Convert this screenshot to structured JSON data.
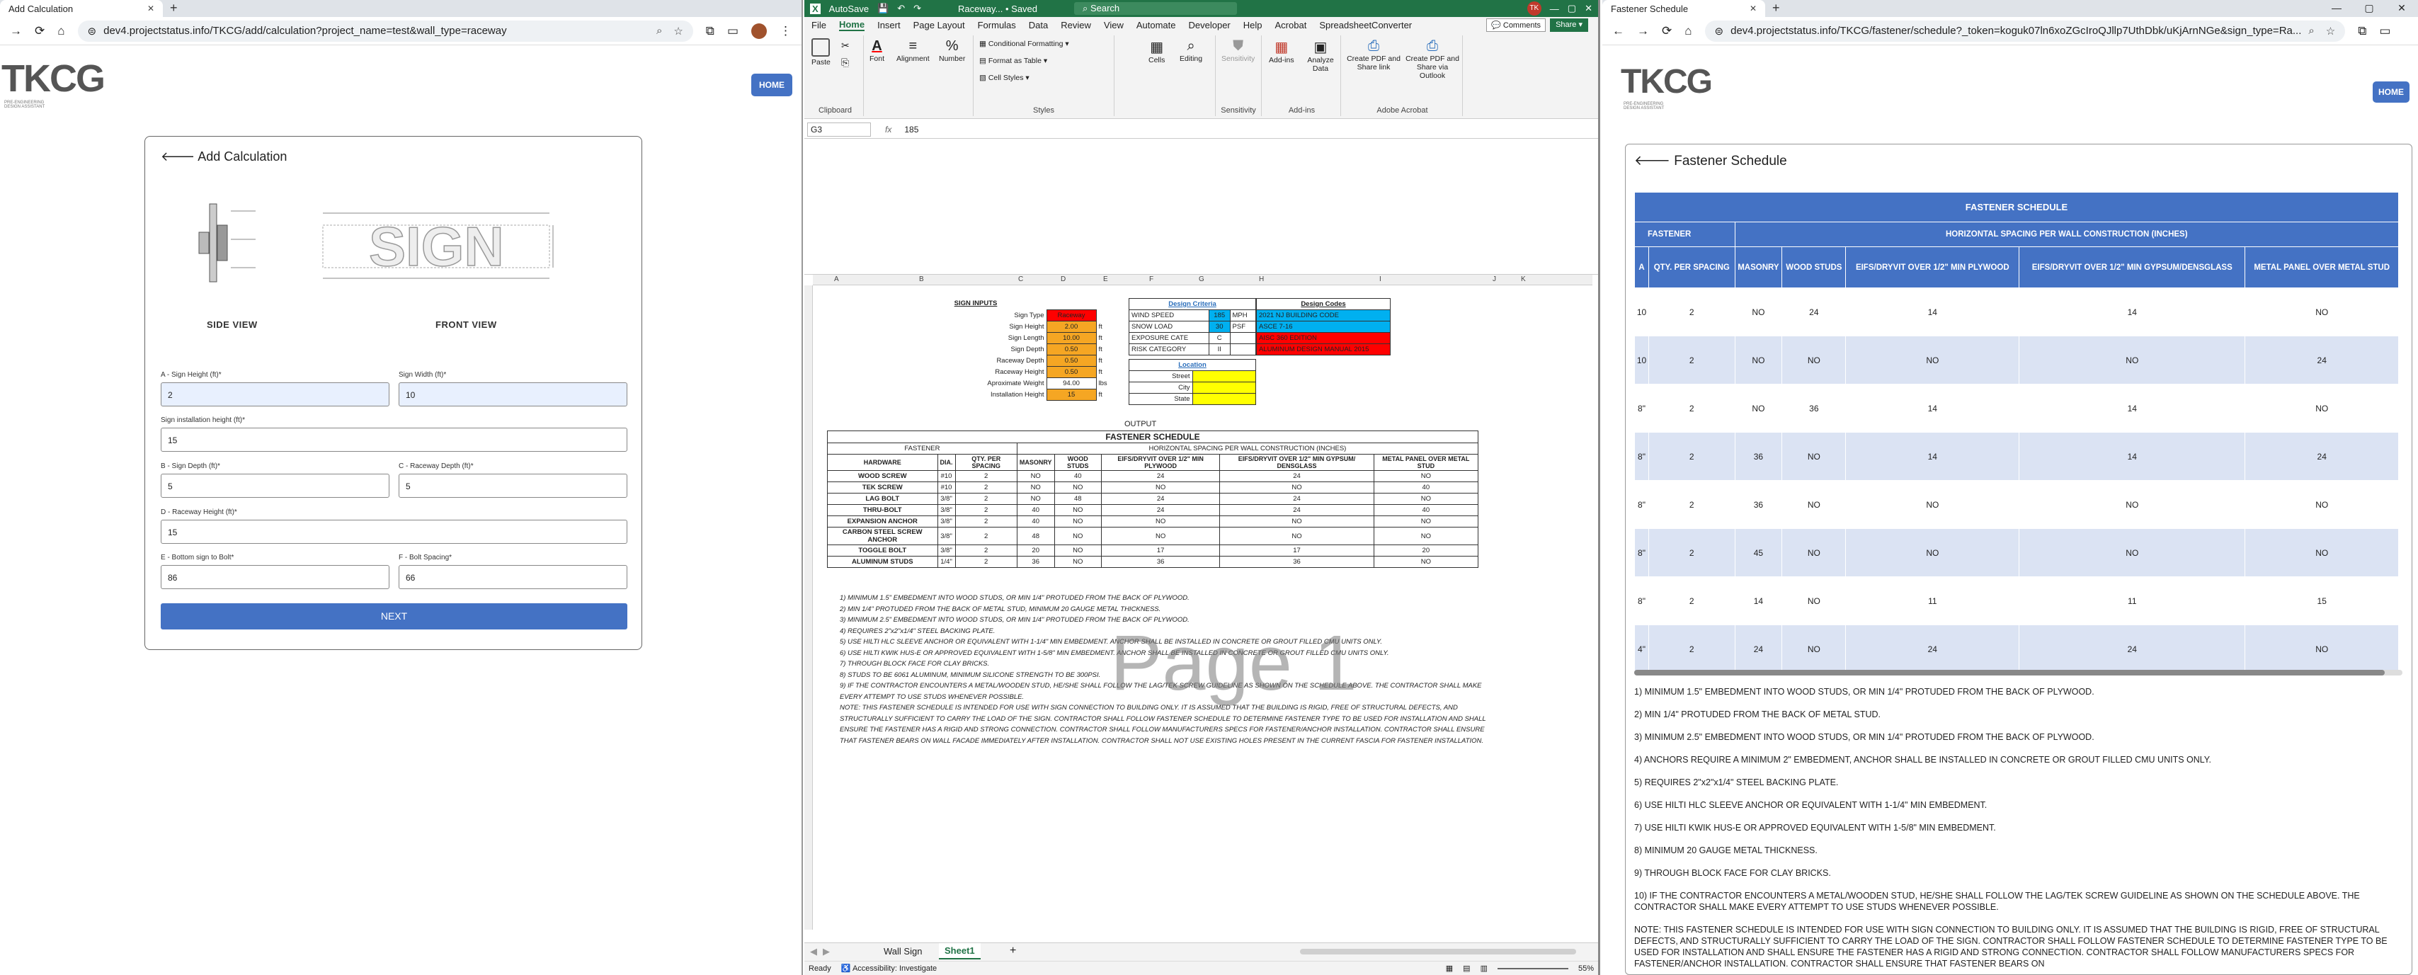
{
  "left": {
    "tab_title": "Add Calculation",
    "url": "dev4.projectstatus.info/TKCG/add/calculation?project_name=test&wall_type=raceway",
    "logo": "TKCG",
    "logo_sub": "PRE-ENGINEERING DESIGN ASSISTANT",
    "home": "HOME",
    "card_title": "Add Calculation",
    "side_view": "SIDE VIEW",
    "front_view": "FRONT VIEW",
    "sign_text": "SIGN",
    "fields": {
      "a_label": "A - Sign Height (ft)*",
      "a_val": "2",
      "w_label": "Sign Width (ft)*",
      "w_val": "10",
      "inst_label": "Sign installation height (ft)*",
      "inst_val": "15",
      "b_label": "B - Sign Depth (ft)*",
      "b_val": "5",
      "c_label": "C - Raceway Depth (ft)*",
      "c_val": "5",
      "d_label": "D - Raceway Height (ft)*",
      "d_val": "15",
      "e_label": "E - Bottom sign to Bolt*",
      "e_val": "86",
      "f_label": "F - Bolt Spacing*",
      "f_val": "66"
    },
    "next": "NEXT"
  },
  "excel": {
    "title": "Raceway... • Saved",
    "autosave": "AutoSave",
    "search": "Search",
    "menu": [
      "File",
      "Home",
      "Insert",
      "Page Layout",
      "Formulas",
      "Data",
      "Review",
      "View",
      "Automate",
      "Developer",
      "Help",
      "Acrobat",
      "SpreadsheetConverter"
    ],
    "comments": "Comments",
    "share": "Share",
    "groups": {
      "clipboard": "Clipboard",
      "styles": "Styles",
      "sensitivity": "Sensitivity",
      "addins": "Add-ins",
      "acrobat": "Adobe Acrobat"
    },
    "buttons": {
      "paste": "Paste",
      "font": "Font",
      "alignment": "Alignment",
      "number": "Number",
      "cond": "Conditional Formatting",
      "table": "Format as Table",
      "cellstyles": "Cell Styles",
      "cells": "Cells",
      "editing": "Editing",
      "sens": "Sensitivity",
      "addins": "Add-ins",
      "analyze": "Analyze Data",
      "pdf1": "Create PDF and Share link",
      "pdf2": "Create PDF and Share via Outlook"
    },
    "cell_ref": "G3",
    "fx": "fx",
    "formula": "185",
    "cols": [
      "A",
      "B",
      "C",
      "D",
      "E",
      "F",
      "G",
      "H",
      "I",
      "J",
      "K"
    ],
    "sign_inputs_title": "SIGN INPUTS",
    "sign_inputs": [
      [
        "Sign Type",
        "Raceway",
        ""
      ],
      [
        "Sign Height",
        "2.00",
        "ft"
      ],
      [
        "Sign Length",
        "10.00",
        "ft"
      ],
      [
        "Sign Depth",
        "0.50",
        "ft"
      ],
      [
        "Raceway Depth",
        "0.50",
        "ft"
      ],
      [
        "Raceway Height",
        "0.50",
        "ft"
      ],
      [
        "Aproximate Weight",
        "94.00",
        "lbs"
      ],
      [
        "Installation Height",
        "15",
        "ft"
      ]
    ],
    "criteria_title": "Design Criteria",
    "criteria": [
      [
        "WIND SPEED",
        "185",
        "MPH"
      ],
      [
        "SNOW LOAD",
        "30",
        "PSF"
      ],
      [
        "EXPOSURE CATE",
        "C",
        ""
      ],
      [
        "RISK CATEGORY",
        "II",
        ""
      ]
    ],
    "codes_title": "Design Codes",
    "codes": [
      "2021 NJ BUILDING CODE",
      "ASCE 7-16",
      "AISC 360 EDITION",
      "ALUMINUM DESIGN MANUAL 2015"
    ],
    "location_title": "Location",
    "location": [
      "Street",
      "City",
      "State"
    ],
    "output": "OUTPUT",
    "schedule_title": "FASTENER SCHEDULE",
    "hdr_fastener": "FASTENER",
    "hdr_spacing": "HORIZONTAL SPACING PER WALL CONSTRUCTION (INCHES)",
    "cols2": [
      "HARDWARE",
      "DIA.",
      "QTY. PER SPACING",
      "MASONRY",
      "WOOD STUDS",
      "EIFS/DRYVIT OVER 1/2\" MIN PLYWOOD",
      "EIFS/DRYVIT OVER 1/2\" MIN GYPSUM/ DENSGLASS",
      "METAL PANEL OVER METAL STUD"
    ],
    "rows": [
      [
        "WOOD SCREW",
        "#10",
        "2",
        "NO",
        "40",
        "24",
        "24",
        "NO"
      ],
      [
        "TEK SCREW",
        "#10",
        "2",
        "NO",
        "NO",
        "NO",
        "NO",
        "40"
      ],
      [
        "LAG BOLT",
        "3/8\"",
        "2",
        "NO",
        "48",
        "24",
        "24",
        "NO"
      ],
      [
        "THRU-BOLT",
        "3/8\"",
        "2",
        "40",
        "NO",
        "24",
        "24",
        "40"
      ],
      [
        "EXPANSION ANCHOR",
        "3/8\"",
        "2",
        "40",
        "NO",
        "NO",
        "NO",
        "NO"
      ],
      [
        "CARBON STEEL SCREW ANCHOR",
        "3/8\"",
        "2",
        "48",
        "NO",
        "NO",
        "NO",
        "NO"
      ],
      [
        "TOGGLE BOLT",
        "3/8\"",
        "2",
        "20",
        "NO",
        "17",
        "17",
        "20"
      ],
      [
        "ALUMINUM STUDS",
        "1/4\"",
        "2",
        "36",
        "NO",
        "36",
        "36",
        "NO"
      ]
    ],
    "notes": [
      "1) MINIMUM 1.5\" EMBEDMENT INTO WOOD STUDS, OR MIN 1/4\" PROTUDED FROM THE BACK OF PLYWOOD.",
      "2) MIN 1/4\" PROTUDED FROM THE BACK OF METAL STUD, MINIMUM 20 GAUGE METAL THICKNESS.",
      "3) MINIMUM 2.5\" EMBEDMENT INTO WOOD STUDS, OR MIN 1/4\" PROTUDED FROM THE BACK OF PLYWOOD.",
      "4) REQUIRES 2\"x2\"x1/4\" STEEL BACKING PLATE.",
      "5) USE HILTI HLC SLEEVE ANCHOR OR EQUIVALENT WITH 1-1/4\" MIN EMBEDMENT. ANCHOR SHALL BE INSTALLED IN CONCRETE OR GROUT FILLED CMU UNITS ONLY.",
      "6) USE HILTI KWIK HUS-E OR APPROVED EQUIVALENT WITH 1-5/8\" MIN EMBEDMENT. ANCHOR SHALL BE INSTALLED IN CONCRETE OR GROUT FILLED CMU UNITS ONLY.",
      "7) THROUGH BLOCK FACE FOR CLAY BRICKS.",
      "8) STUDS TO BE 6061 ALUMINUM, MINIMUM SILICONE STRENGTH TO BE 300PSI.",
      "9) IF THE CONTRACTOR ENCOUNTERS A METAL/WOODEN STUD, HE/SHE SHALL FOLLOW THE LAG/TEK SCREW GUIDELINE AS SHOWN ON THE SCHEDULE ABOVE. THE CONTRACTOR SHALL MAKE EVERY ATTEMPT TO USE STUDS WHENEVER POSSIBLE.",
      "NOTE: THIS FASTENER SCHEDULE IS INTENDED FOR USE WITH SIGN CONNECTION TO BUILDING ONLY. IT IS ASSUMED THAT THE BUILDING IS RIGID, FREE OF STRUCTURAL DEFECTS, AND STRUCTURALLY SUFFICIENT TO CARRY THE LOAD OF THE SIGN. CONTRACTOR SHALL FOLLOW FASTENER SCHEDULE TO DETERMINE FASTENER TYPE TO BE USED FOR INSTALLATION AND SHALL ENSURE THE FASTENER HAS A RIGID AND STRONG CONNECTION. CONTRACTOR SHALL FOLLOW MANUFACTURERS SPECS FOR FASTENER/ANCHOR INSTALLATION. CONTRACTOR SHALL ENSURE THAT FASTENER BEARS ON WALL FACADE IMMEDIATELY AFTER INSTALLATION. CONTRACTOR SHALL NOT USE EXISTING HOLES PRESENT IN THE CURRENT FASCIA FOR FASTENER INSTALLATION."
    ],
    "watermark": "Page 1",
    "sheet_tabs": [
      "Wall Sign",
      "Sheet1"
    ],
    "status": "Ready",
    "accessibility": "Accessibility: Investigate",
    "zoom": "55%"
  },
  "right": {
    "tab_title": "Fastener Schedule",
    "url": "dev4.projectstatus.info/TKCG/fastener/schedule?_token=koguk07ln6xoZGcIroQJllp7UthDbk/uKjArnNGe&sign_type=Ra...",
    "logo": "TKCG",
    "logo_sub": "PRE-ENGINEERING DESIGN ASSISTANT",
    "home": "HOME",
    "title": "Fastener Schedule",
    "table_title": "FASTENER SCHEDULE",
    "hdr_fastener": "FASTENER",
    "hdr_spacing": "HORIZONTAL SPACING PER WALL CONSTRUCTION (INCHES)",
    "cols": [
      "A",
      "QTY. PER SPACING",
      "MASONRY",
      "WOOD STUDS",
      "EIFS/DRYVIT OVER 1/2\" MIN PLYWOOD",
      "EIFS/DRYVIT OVER 1/2\" MIN GYPSUM/DENSGLASS",
      "METAL PANEL OVER METAL STUD"
    ],
    "rows": [
      [
        "10",
        "2",
        "NO",
        "24",
        "14",
        "14",
        "NO"
      ],
      [
        "10",
        "2",
        "NO",
        "NO",
        "NO",
        "NO",
        "24"
      ],
      [
        "8\"",
        "2",
        "NO",
        "36",
        "14",
        "14",
        "NO"
      ],
      [
        "8\"",
        "2",
        "36",
        "NO",
        "14",
        "14",
        "24"
      ],
      [
        "8\"",
        "2",
        "36",
        "NO",
        "NO",
        "NO",
        "NO"
      ],
      [
        "8\"",
        "2",
        "45",
        "NO",
        "NO",
        "NO",
        "NO"
      ],
      [
        "8\"",
        "2",
        "14",
        "NO",
        "11",
        "11",
        "15"
      ],
      [
        "4\"",
        "2",
        "24",
        "NO",
        "24",
        "24",
        "NO"
      ]
    ],
    "notes": [
      "1) MINIMUM 1.5\" EMBEDMENT INTO WOOD STUDS, OR MIN 1/4\" PROTUDED FROM THE BACK OF PLYWOOD.",
      "2) MIN 1/4\" PROTUDED FROM THE BACK OF METAL STUD.",
      "3) MINIMUM 2.5\" EMBEDMENT INTO WOOD STUDS, OR MIN 1/4\" PROTUDED FROM THE BACK OF PLYWOOD.",
      "4) ANCHORS REQUIRE A MINIMUM 2\" EMBEDMENT, ANCHOR SHALL BE INSTALLED IN CONCRETE OR GROUT FILLED CMU UNITS ONLY.",
      "5) REQUIRES 2\"x2\"x1/4\" STEEL BACKING PLATE.",
      "6) USE HILTI HLC SLEEVE ANCHOR OR EQUIVALENT WITH 1-1/4\" MIN EMBEDMENT.",
      "7) USE HILTI KWIK HUS-E OR APPROVED EQUIVALENT WITH 1-5/8\" MIN EMBEDMENT.",
      "8) MINIMUM 20 GAUGE METAL THICKNESS.",
      "9) THROUGH BLOCK FACE FOR CLAY BRICKS.",
      "10) IF THE CONTRACTOR ENCOUNTERS A METAL/WOODEN STUD, HE/SHE SHALL FOLLOW THE LAG/TEK SCREW GUIDELINE AS SHOWN ON THE SCHEDULE ABOVE. THE CONTRACTOR SHALL MAKE EVERY ATTEMPT TO USE STUDS WHENEVER POSSIBLE.",
      "NOTE: THIS FASTENER SCHEDULE IS INTENDED FOR USE WITH SIGN CONNECTION TO BUILDING ONLY. IT IS ASSUMED THAT THE BUILDING IS RIGID, FREE OF STRUCTURAL DEFECTS, AND STRUCTURALLY SUFFICIENT TO CARRY THE LOAD OF THE SIGN. CONTRACTOR SHALL FOLLOW FASTENER SCHEDULE TO DETERMINE FASTENER TYPE TO BE USED FOR INSTALLATION AND SHALL ENSURE THE FASTENER HAS A RIGID AND STRONG CONNECTION. CONTRACTOR SHALL FOLLOW MANUFACTURERS SPECS FOR FASTENER/ANCHOR INSTALLATION. CONTRACTOR SHALL ENSURE THAT FASTENER BEARS ON"
    ]
  },
  "colors": {
    "accent": "#4472c4",
    "excel_green": "#217346",
    "orange": "#f5a623",
    "yellow": "#ffff00",
    "red": "#ff0000",
    "cyan": "#00b0f0"
  }
}
